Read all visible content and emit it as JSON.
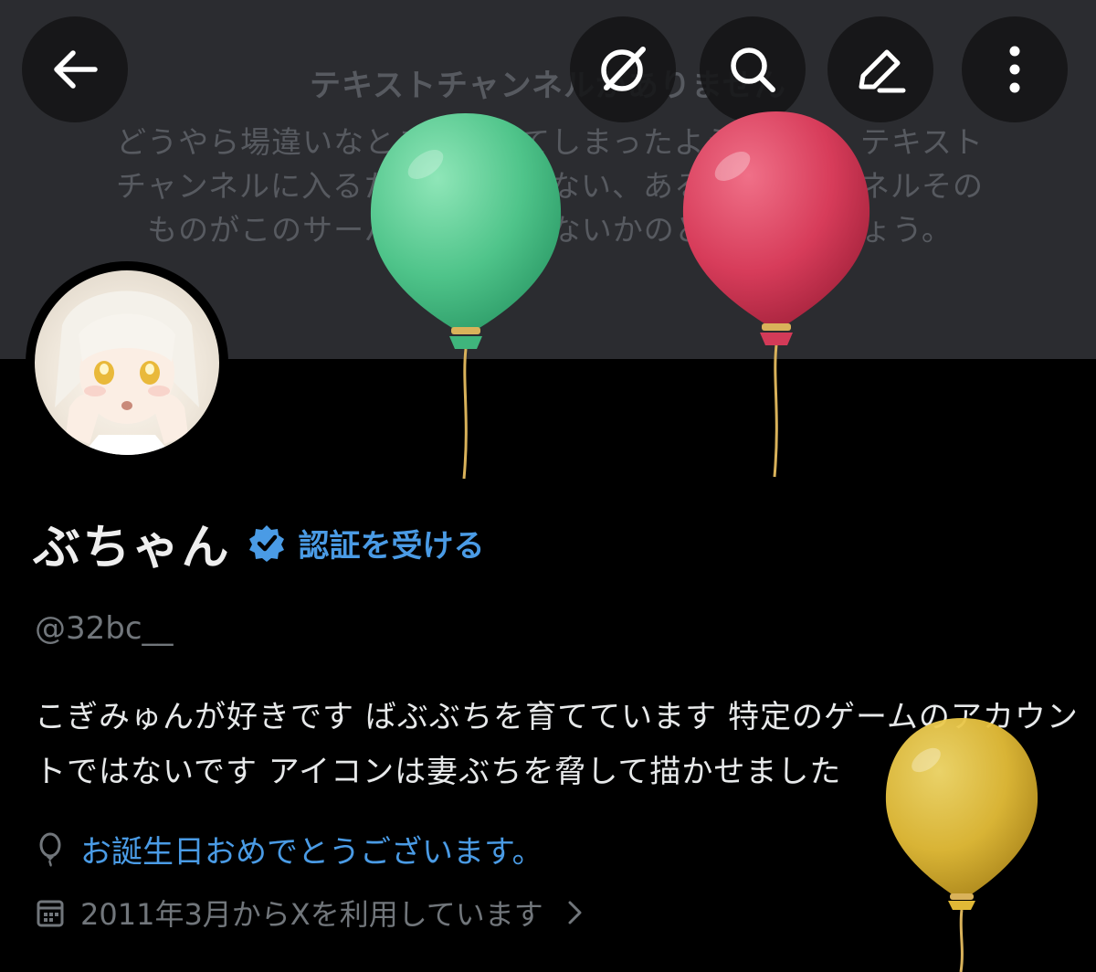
{
  "banner": {
    "title": "テキストチャンネルがありません",
    "text": "どうやら場違いなところに来てしまったようですね。テキストチャンネルに入るための権限がない、あるいはチャンネルそのものがこのサーバーに存在しないかのどちらかでしょう。"
  },
  "toolbar": {
    "back_icon": "arrow-left-icon",
    "grok_icon": "grok-icon",
    "search_icon": "search-icon",
    "edit_icon": "pencil-icon",
    "more_icon": "more-vertical-icon"
  },
  "profile": {
    "display_name": "ぶちゃん",
    "verify_label": "認証を受ける",
    "handle": "@32bc__",
    "bio": "こぎみゅんが好きです ばぶぶちを育てています 特定のゲームのアカウントではないです アイコンは妻ぶちを脅して描かせました",
    "birthday": "お誕生日おめでとうございます。",
    "joined": "2011年3月からXを利用しています"
  },
  "colors": {
    "background": "#000000",
    "banner": "#2b2c30",
    "accent": "#4a9be5",
    "muted": "#71767b",
    "balloon_green": "#5fcf96",
    "balloon_red": "#d9435f",
    "balloon_yellow": "#e6c23d"
  }
}
